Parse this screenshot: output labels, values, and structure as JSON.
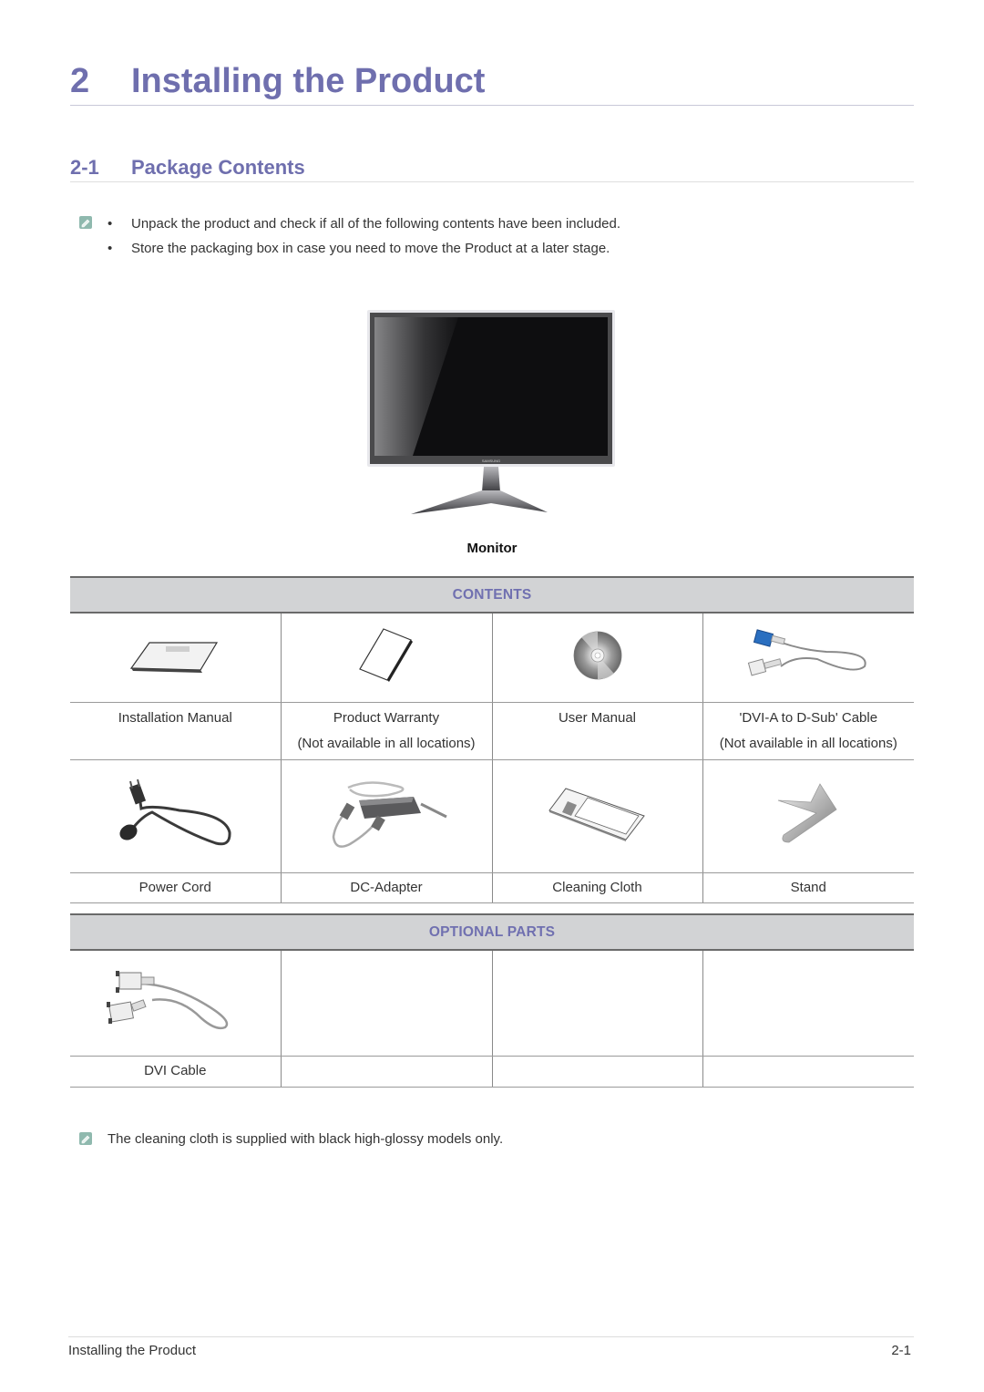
{
  "chapter": {
    "number": "2",
    "title": "Installing the Product"
  },
  "section": {
    "number": "2-1",
    "title": "Package Contents"
  },
  "notes": {
    "icon": "note-pencil-icon",
    "bullets": [
      "Unpack the product and check if all of the following contents have been included.",
      "Store the packaging box in case you need to move the Product at a later stage."
    ],
    "bullet_char": "•",
    "bottom_note": "The cleaning cloth is supplied with black high-glossy models only."
  },
  "monitor": {
    "caption": "Monitor",
    "brand_text": "SAMSUNG"
  },
  "contents_table": {
    "header": "CONTENTS",
    "rows": [
      [
        {
          "label": "Installation Manual",
          "sub": "",
          "icon": "installation-manual-icon"
        },
        {
          "label": "Product Warranty",
          "sub": "(Not available in all locations)",
          "icon": "product-warranty-icon"
        },
        {
          "label": "User Manual",
          "sub": "",
          "icon": "cd-disc-icon"
        },
        {
          "label": "'DVI-A to D-Sub' Cable",
          "sub": "(Not available in all locations)",
          "icon": "dvi-dsub-cable-icon"
        }
      ],
      [
        {
          "label": "Power Cord",
          "sub": "",
          "icon": "power-cord-icon"
        },
        {
          "label": "DC-Adapter",
          "sub": "",
          "icon": "dc-adapter-icon"
        },
        {
          "label": "Cleaning Cloth",
          "sub": "",
          "icon": "cleaning-cloth-icon"
        },
        {
          "label": "Stand",
          "sub": "",
          "icon": "stand-icon"
        }
      ]
    ]
  },
  "optional_table": {
    "header": "OPTIONAL PARTS",
    "rows": [
      [
        {
          "label": "DVI Cable",
          "sub": "",
          "icon": "dvi-cable-icon"
        },
        {
          "label": "",
          "sub": ""
        },
        {
          "label": "",
          "sub": ""
        },
        {
          "label": "",
          "sub": ""
        }
      ]
    ]
  },
  "footer": {
    "left": "Installing the Product",
    "right": "2-1"
  },
  "colors": {
    "heading": "#6f6fae",
    "table_header_bg": "#d2d3d5",
    "note_icon": "#8fb9ae"
  }
}
